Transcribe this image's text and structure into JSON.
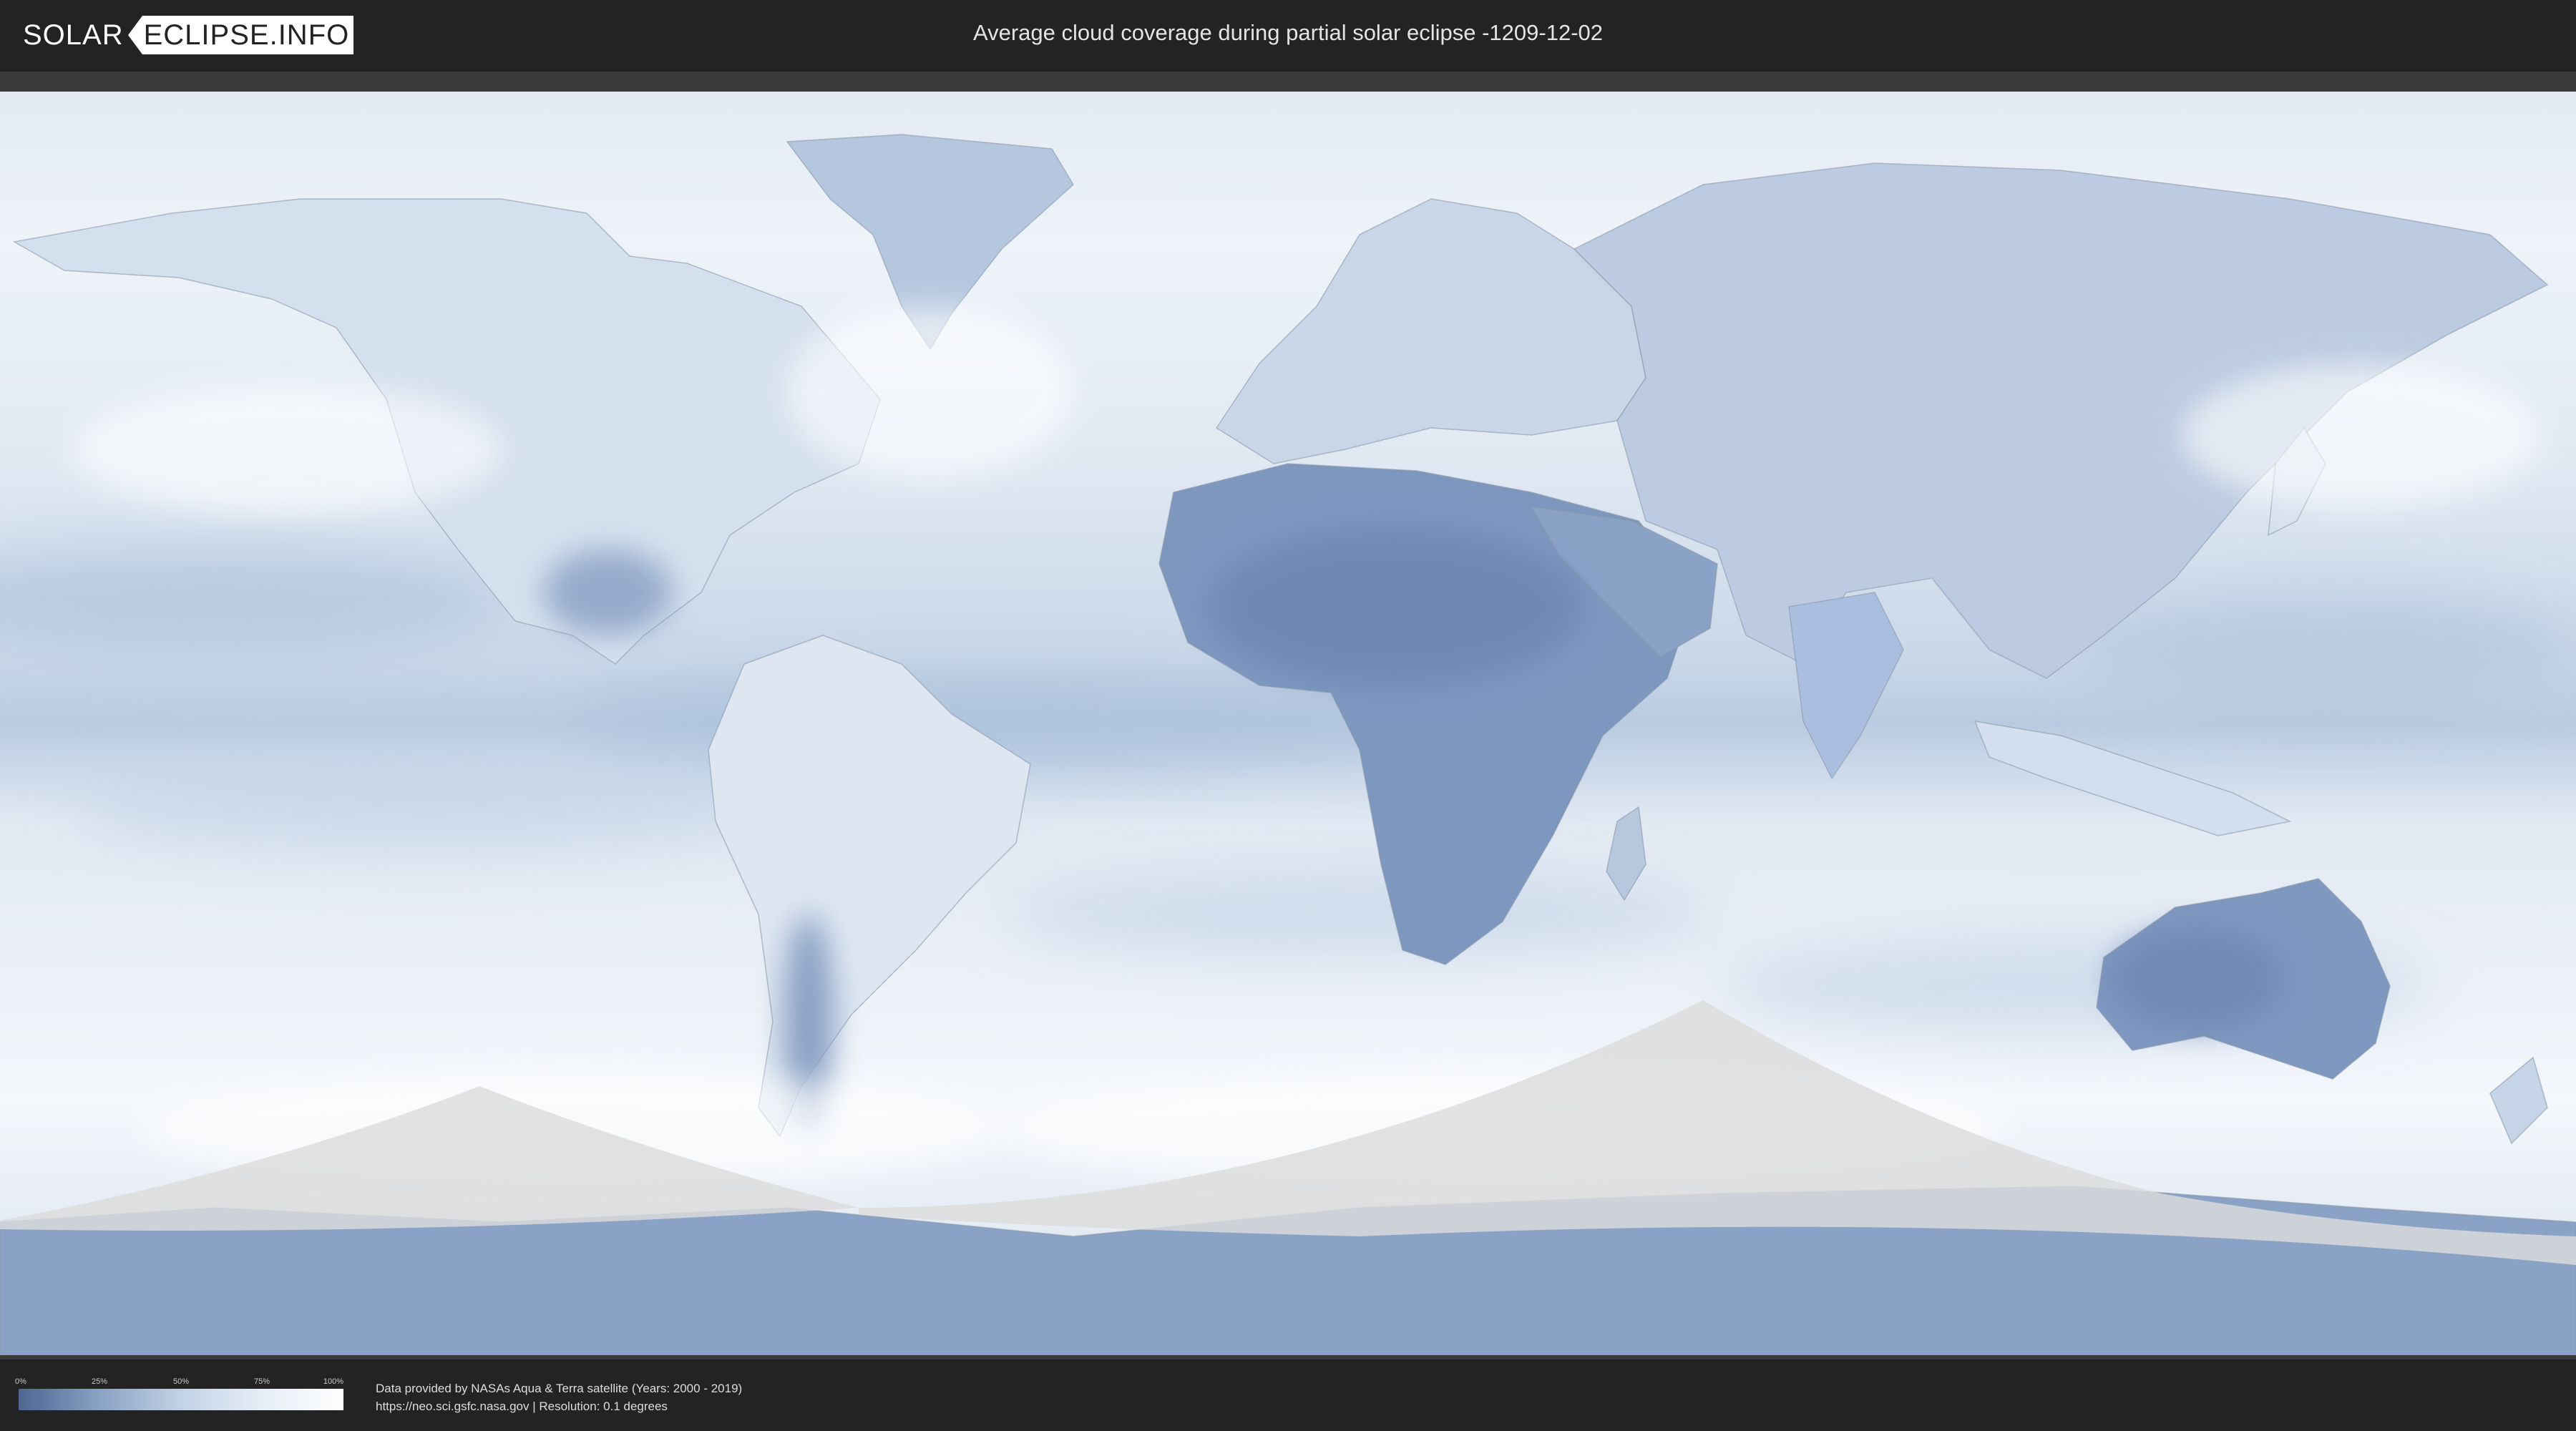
{
  "header": {
    "logo_left": "SOLAR",
    "logo_right": "ECLIPSE.INFO",
    "title": "Average cloud coverage during partial solar eclipse -1209-12-02"
  },
  "legend": {
    "ticks": [
      "0%",
      "25%",
      "50%",
      "75%",
      "100%"
    ],
    "gradient_colors": [
      "#4e6691",
      "#8aa2c4",
      "#c2d2e6",
      "#e6edf6",
      "#ffffff"
    ]
  },
  "credits": {
    "line1": "Data provided by NASAs Aqua & Terra satellite (Years: 2000 - 2019)",
    "line2": "https://neo.sci.gsfc.nasa.gov | Resolution: 0.1 degrees"
  },
  "colors": {
    "background": "#232323",
    "clear_sky": "#5a77a3",
    "cloud_cover": "#f4f7fb",
    "eclipse_shadow": "#dcdcdc"
  }
}
